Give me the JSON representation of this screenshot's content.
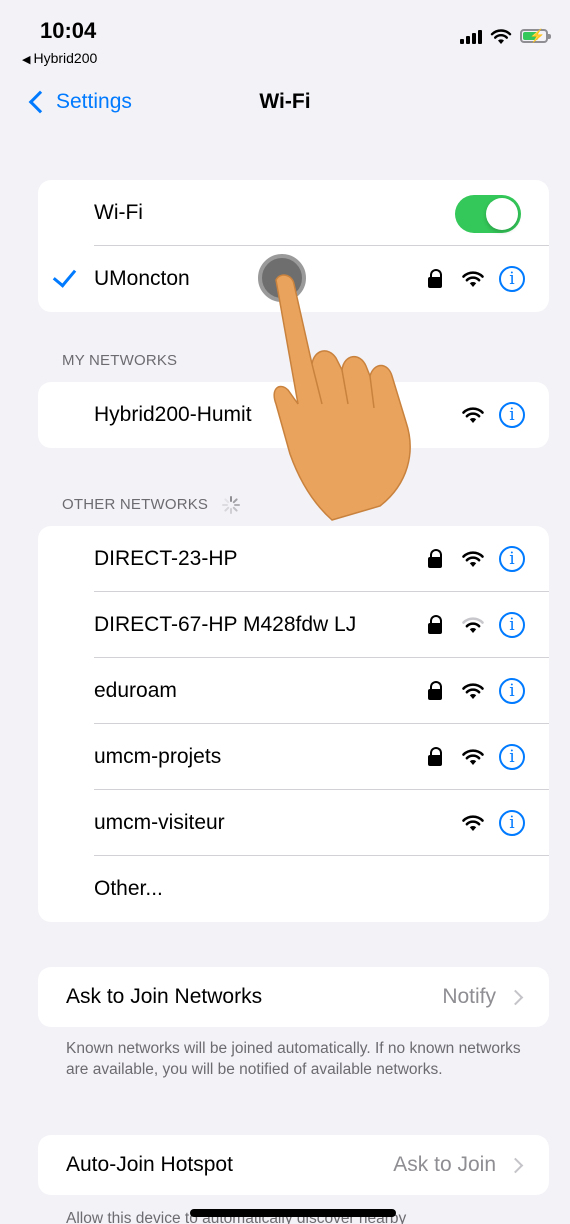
{
  "status_bar": {
    "time": "10:04",
    "back_app": "Hybrid200",
    "back_arrow": "◀",
    "battery_bolt": "⚡",
    "battery_color": "#34c759"
  },
  "nav": {
    "back_label": "Settings",
    "title": "Wi-Fi"
  },
  "wifi_toggle": {
    "label": "Wi-Fi",
    "on": true,
    "color": "#34c759"
  },
  "connected": {
    "name": "UMoncton",
    "locked": true
  },
  "my_networks": {
    "header": "MY NETWORKS",
    "items": [
      {
        "name": "Hybrid200-Humit",
        "locked": false
      }
    ]
  },
  "other_networks": {
    "header": "OTHER NETWORKS",
    "items": [
      {
        "name": "DIRECT-23-HP",
        "locked": true
      },
      {
        "name": "DIRECT-67-HP M428fdw LJ",
        "locked": true
      },
      {
        "name": "eduroam",
        "locked": true
      },
      {
        "name": "umcm-projets",
        "locked": true
      },
      {
        "name": "umcm-visiteur",
        "locked": false
      }
    ],
    "other_label": "Other..."
  },
  "ask_to_join": {
    "label": "Ask to Join Networks",
    "value": "Notify",
    "footer": "Known networks will be joined automatically. If no known networks are available, you will be notified of available networks."
  },
  "auto_join": {
    "label": "Auto-Join Hotspot",
    "value": "Ask to Join",
    "footer": "Allow this device to automatically discover nearby"
  },
  "accent_color": "#007aff",
  "info_glyph": "i"
}
